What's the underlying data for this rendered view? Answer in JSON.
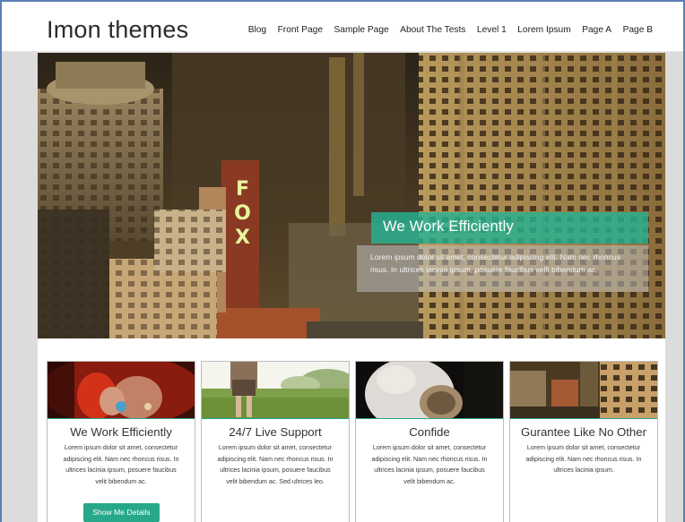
{
  "site": {
    "title": "Imon themes"
  },
  "nav": {
    "items": [
      {
        "label": "Blog"
      },
      {
        "label": "Front Page"
      },
      {
        "label": "Sample Page"
      },
      {
        "label": "About The Tests"
      },
      {
        "label": "Level 1"
      },
      {
        "label": "Lorem Ipsum"
      },
      {
        "label": "Page A"
      },
      {
        "label": "Page B"
      }
    ]
  },
  "hero": {
    "heading": "We Work Efficiently",
    "text": "Lorem ipsum dolor sit amet, consectetur adipiscing elit. Nam nec rhoncus risus. In ultrices lacinia ipsum, posuere faucibus velit bibendum ac.",
    "sign_text": "FOX",
    "accent_color": "#26b292"
  },
  "features": [
    {
      "title": "We Work Efficiently",
      "text": "Lorem ipsum dolor sit amet, consectetur adipiscing elit. Nam nec rhoncus risus. In ultrices lacinia ipsum, posuere faucibus velit bibendum ac.",
      "button": "Show Me Details"
    },
    {
      "title": "24/7 Live Support",
      "text": "Lorem ipsum dolor sit amet, consectetur adipiscing elit. Nam nec rhoncus risus. In ultrices lacinia ipsum, posuere faucibus velit bibendum ac. Sed ultrices leo."
    },
    {
      "title": "Confide",
      "text": "Lorem ipsum dolor sit amet, consectetur adipiscing elit. Nam nec rhoncus risus. In ultrices lacinia ipsum, posuere faucibus velit bibendum ac."
    },
    {
      "title": "Gurantee Like No Other",
      "text": "Lorem ipsum dolor sit amet, consectetur adipiscing elit. Nam nec rhoncus risus. In ultrices lacinia ipsum."
    }
  ]
}
